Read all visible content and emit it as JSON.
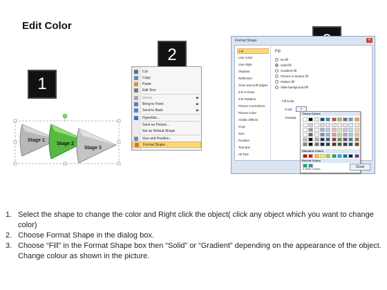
{
  "slide": {
    "title": "Edit Color"
  },
  "steps": [
    "1",
    "2",
    "3"
  ],
  "diagram": {
    "stages": [
      "Stage 1",
      "Stage 2",
      "Stage 3"
    ]
  },
  "context_menu": {
    "items": [
      {
        "label": "Cut",
        "icon": "scissors-icon",
        "dim": false,
        "submenu": false
      },
      {
        "label": "Copy",
        "icon": "copy-icon",
        "dim": false,
        "submenu": false
      },
      {
        "label": "Paste",
        "icon": "paste-icon",
        "dim": false,
        "submenu": false
      },
      {
        "label": "Edit Text",
        "icon": "edit-text-icon",
        "dim": false,
        "submenu": false
      },
      {
        "label": "Group",
        "icon": "group-icon",
        "dim": true,
        "submenu": true
      },
      {
        "label": "Bring to Front",
        "icon": "bring-front-icon",
        "dim": false,
        "submenu": true
      },
      {
        "label": "Send to Back",
        "icon": "send-back-icon",
        "dim": false,
        "submenu": true
      },
      {
        "label": "Hyperlink...",
        "icon": "hyperlink-icon",
        "dim": false,
        "submenu": false
      },
      {
        "label": "Save as Picture...",
        "icon": "",
        "dim": false,
        "submenu": false
      },
      {
        "label": "Set as Default Shape",
        "icon": "",
        "dim": false,
        "submenu": false
      },
      {
        "label": "Size and Position...",
        "icon": "size-icon",
        "dim": false,
        "submenu": false
      },
      {
        "label": "Format Shape...",
        "icon": "format-shape-icon",
        "dim": false,
        "submenu": false,
        "highlight": true
      }
    ]
  },
  "dialog": {
    "title": "Format Shape",
    "categories": [
      "Fill",
      "Line Color",
      "Line Style",
      "Shadow",
      "Reflection",
      "Glow and Soft Edges",
      "3-D Format",
      "3-D Rotation",
      "Picture Corrections",
      "Picture Color",
      "Artistic Effects",
      "Crop",
      "Size",
      "Position",
      "Text Box",
      "Alt Text"
    ],
    "selected_category": "Fill",
    "fill_heading": "Fill",
    "fill_options": [
      "No fill",
      "Solid fill",
      "Gradient fill",
      "Picture or texture fill",
      "Pattern fill",
      "Slide background fill"
    ],
    "selected_fill": "Solid fill",
    "fill_color_label": "Fill Color",
    "color_label": "Color:",
    "transparency_label": "Transpa",
    "palette": {
      "theme_colors_label": "Theme Colors",
      "standard_colors_label": "Standard Colors",
      "recent_colors_label": "Recent Colors",
      "more_colors_label": "More Colors...",
      "theme_top": [
        "#ffffff",
        "#000000",
        "#eeece1",
        "#1f497d",
        "#4f81bd",
        "#c0504d",
        "#9bbb59",
        "#8064a2",
        "#4bacc6",
        "#f79646"
      ],
      "standard": [
        "#c00000",
        "#ff0000",
        "#ffc000",
        "#ffff00",
        "#92d050",
        "#00b050",
        "#00b0f0",
        "#0070c0",
        "#002060",
        "#7030a0"
      ],
      "recent": [
        "#00b050",
        "#4f81bd"
      ]
    },
    "close_label": "Close"
  },
  "instructions": [
    {
      "num": "1.",
      "text": "Select the shape to change the color and Right click the object( click any object which you want to change color)"
    },
    {
      "num": "2.",
      "text": "Choose Format Shape in the dialog box."
    },
    {
      "num": "3.",
      "text": "Choose “Fill” in the Format Shape box then “Solid” or “Gradient” depending on the appearance of the object. Change colour as shown in the picture."
    }
  ]
}
